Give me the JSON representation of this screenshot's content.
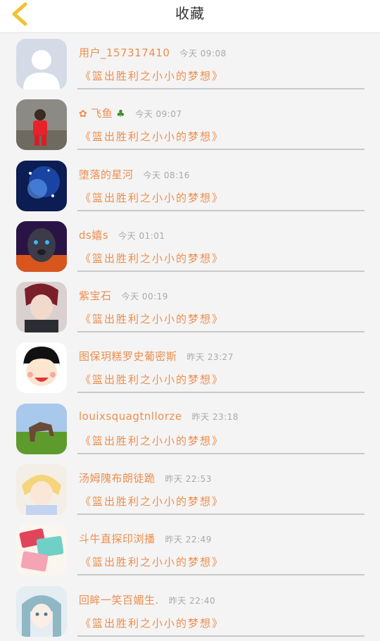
{
  "header": {
    "title": "收藏",
    "back_icon": "chevron-left-icon",
    "accent_color": "#f2c12e"
  },
  "favorites": [
    {
      "name": "用户_157317410",
      "time": "今天 09:08",
      "content": "《篮出胜利之小小的梦想》",
      "avatar": "default-user"
    },
    {
      "name": "飞鱼",
      "prefix_icon": "flower-icon",
      "suffix_icon": "clover-icon",
      "time": "今天 09:07",
      "content": "《篮出胜利之小小的梦想》",
      "avatar": "boy-in-red"
    },
    {
      "name": "堕落的星河",
      "time": "今天 08:16",
      "content": "《篮出胜利之小小的梦想》",
      "avatar": "blue-galaxy"
    },
    {
      "name": "ds嬉s",
      "time": "今天 01:01",
      "content": "《篮出胜利之小小的梦想》",
      "avatar": "lion"
    },
    {
      "name": "紫宝石",
      "time": "今天 00:19",
      "content": "《篮出胜利之小小的梦想》",
      "avatar": "anime-boy-red-hair"
    },
    {
      "name": "图保玥糕罗史葡密斯",
      "time": "昨天 23:27",
      "content": "《篮出胜利之小小的梦想》",
      "avatar": "cartoon-girl"
    },
    {
      "name": "louixsquagtnllorze",
      "time": "昨天 23:18",
      "content": "《篮出胜利之小小的梦想》",
      "avatar": "horse"
    },
    {
      "name": "汤姆隗布朗徒跪",
      "time": "昨天 22:53",
      "content": "《篮出胜利之小小的梦想》",
      "avatar": "anime-blond"
    },
    {
      "name": "斗牛直探印浏播",
      "time": "昨天 22:49",
      "content": "《篮出胜利之小小的梦想》",
      "avatar": "cosmetics"
    },
    {
      "name": "回眸一笑百媚生.",
      "time": "昨天 22:40",
      "content": "《篮出胜利之小小的梦想》",
      "avatar": "anime-girl-teal"
    }
  ]
}
